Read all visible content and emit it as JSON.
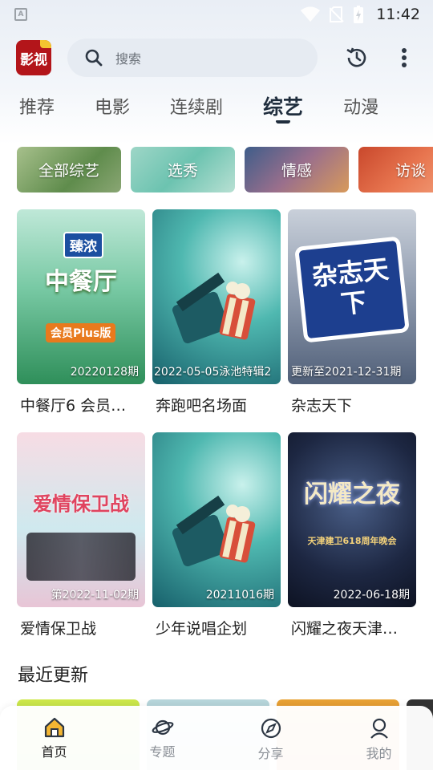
{
  "status_bar": {
    "time": "11:42",
    "notif_letter": "A"
  },
  "header": {
    "logo_text": "影视",
    "search_placeholder": "搜索"
  },
  "category_tabs": [
    {
      "label": "推荐",
      "active": false
    },
    {
      "label": "电影",
      "active": false
    },
    {
      "label": "连续剧",
      "active": false
    },
    {
      "label": "综艺",
      "active": true
    },
    {
      "label": "动漫",
      "active": false
    }
  ],
  "sub_categories": [
    "全部综艺",
    "选秀",
    "情感",
    "访谈"
  ],
  "cards": [
    {
      "title": "中餐厅6 会员…",
      "badge": "20220128期",
      "poster_text": "中餐厅",
      "poster_sub": "会员Plus版",
      "brand": "臻浓"
    },
    {
      "title": "奔跑吧名场面",
      "badge": "2022-05-05泳池特辑2"
    },
    {
      "title": "杂志天下",
      "badge": "更新至2021-12-31期",
      "poster_text": "杂志天下"
    },
    {
      "title": "爱情保卫战",
      "badge": "第2022-11-02期",
      "poster_text": "爱情保卫战"
    },
    {
      "title": "少年说唱企划",
      "badge": "20211016期"
    },
    {
      "title": "闪耀之夜天津…",
      "badge": "2022-06-18期",
      "poster_text": "闪耀之夜",
      "poster_sub": "天津建卫618周年晚会"
    }
  ],
  "recent_section": {
    "title": "最近更新"
  },
  "bottom_nav": [
    {
      "label": "首页",
      "icon": "home-icon",
      "active": true
    },
    {
      "label": "专题",
      "icon": "planet-icon",
      "active": false
    },
    {
      "label": "分享",
      "icon": "compass-icon",
      "active": false
    },
    {
      "label": "我的",
      "icon": "user-icon",
      "active": false
    }
  ],
  "colors": {
    "accent": "#1f2d3d",
    "nav_active": "#f0a21b",
    "logo_bg": "#b3151a"
  }
}
